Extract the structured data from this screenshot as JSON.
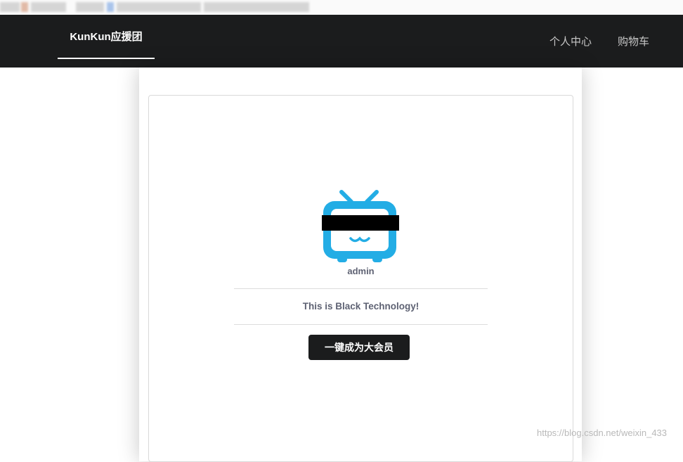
{
  "navbar": {
    "brand": "KunKun应援团",
    "links": [
      "个人中心",
      "购物车"
    ]
  },
  "profile": {
    "avatar_icon": "tv-mascot-icon",
    "username": "admin",
    "tagline": "This is Black Technology!",
    "vip_button_label": "一键成为大会员"
  },
  "watermark": "https://blog.csdn.net/weixin_433",
  "colors": {
    "navbar_bg": "#1b1c1d",
    "accent_blue": "#23ade5",
    "text_muted": "#5e6273",
    "button_bg": "#1b1c1d"
  }
}
